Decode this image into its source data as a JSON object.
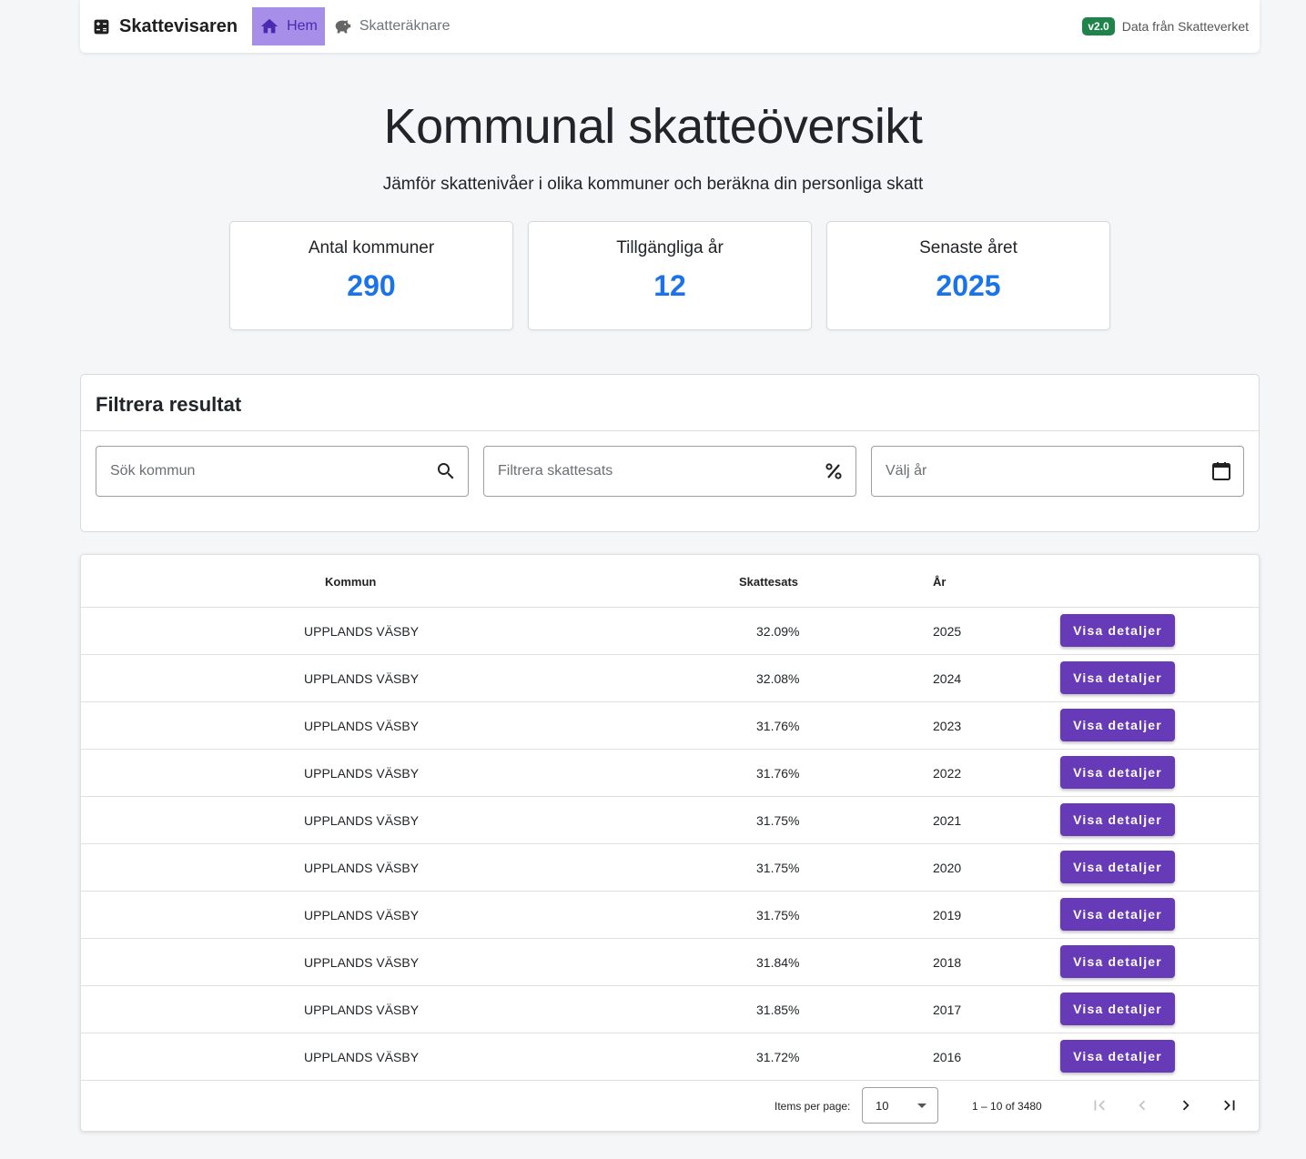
{
  "navbar": {
    "brand": "Skattevisaren",
    "links": [
      {
        "label": "Hem",
        "active": true
      },
      {
        "label": "Skatteräknare",
        "active": false
      }
    ],
    "version": "v2.0",
    "source": "Data från Skatteverket"
  },
  "hero": {
    "title": "Kommunal skatteöversikt",
    "subtitle": "Jämför skattenivåer i olika kommuner och beräkna din personliga skatt"
  },
  "stats": [
    {
      "label": "Antal kommuner",
      "value": "290"
    },
    {
      "label": "Tillgängliga år",
      "value": "12"
    },
    {
      "label": "Senaste året",
      "value": "2025"
    }
  ],
  "filter": {
    "title": "Filtrera resultat",
    "search_placeholder": "Sök kommun",
    "rate_placeholder": "Filtrera skattesats",
    "year_placeholder": "Välj år"
  },
  "table": {
    "headers": {
      "kommun": "Kommun",
      "skattesats": "Skattesats",
      "ar": "År"
    },
    "button_label": "Visa detaljer",
    "rows": [
      {
        "kommun": "UPPLANDS VÄSBY",
        "skattesats": "32.09%",
        "ar": "2025"
      },
      {
        "kommun": "UPPLANDS VÄSBY",
        "skattesats": "32.08%",
        "ar": "2024"
      },
      {
        "kommun": "UPPLANDS VÄSBY",
        "skattesats": "31.76%",
        "ar": "2023"
      },
      {
        "kommun": "UPPLANDS VÄSBY",
        "skattesats": "31.76%",
        "ar": "2022"
      },
      {
        "kommun": "UPPLANDS VÄSBY",
        "skattesats": "31.75%",
        "ar": "2021"
      },
      {
        "kommun": "UPPLANDS VÄSBY",
        "skattesats": "31.75%",
        "ar": "2020"
      },
      {
        "kommun": "UPPLANDS VÄSBY",
        "skattesats": "31.75%",
        "ar": "2019"
      },
      {
        "kommun": "UPPLANDS VÄSBY",
        "skattesats": "31.84%",
        "ar": "2018"
      },
      {
        "kommun": "UPPLANDS VÄSBY",
        "skattesats": "31.85%",
        "ar": "2017"
      },
      {
        "kommun": "UPPLANDS VÄSBY",
        "skattesats": "31.72%",
        "ar": "2016"
      }
    ]
  },
  "paginator": {
    "items_per_page_label": "Items per page:",
    "items_per_page": "10",
    "range": "1 – 10 of 3480"
  },
  "colors": {
    "accent": "#673ab7",
    "stat_value": "#1a73e8",
    "badge": "#1e8449",
    "active_nav": "#a78ee8"
  }
}
